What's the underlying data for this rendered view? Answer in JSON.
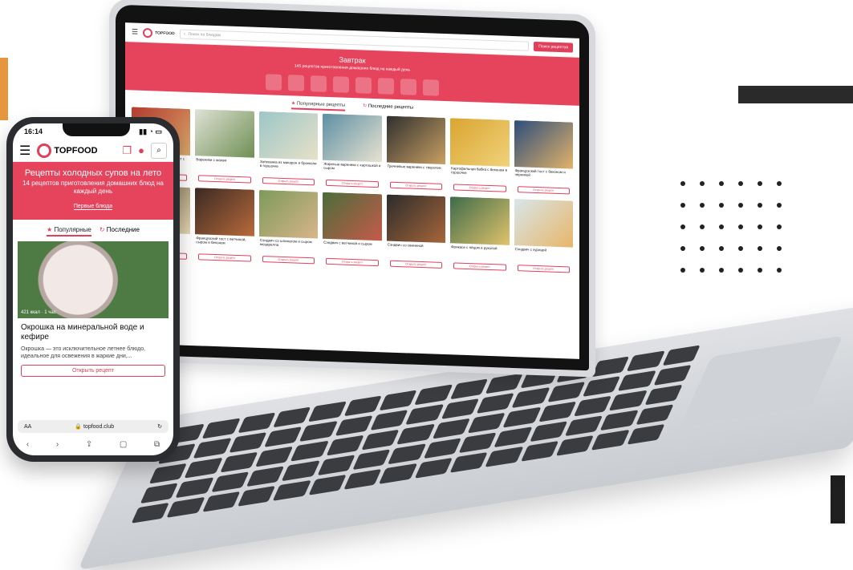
{
  "laptop": {
    "site": {
      "logo": "TOPFOOD",
      "search_placeholder": "Поиск по блюдам",
      "search_button": "Поиск рецептов",
      "hero_title": "Завтрак",
      "hero_subtitle": "145 рецептов приготовления домашних блюд на каждый день",
      "tabs": [
        "Популярные рецепты",
        "Последние рецепты"
      ],
      "cards": [
        "Хрустящий французский тост с малиной",
        "Вареники с маком",
        "Запеканка из макарон и брокколи в горшочке",
        "Жареные вареники с картошкой и сыром",
        "Гречневые вареники с творогом",
        "Картофельная бабка с беконом в горшочке",
        "Французский тост с беконом и черникой",
        "Запеканка из капусты в мультиварке",
        "Французский тост с ветчиной, сыром и беконом",
        "Сэндвич со шпинатом и сыром моцарелла",
        "Сэндвич с ветчиной и сыром",
        "Сэндвич со свининой",
        "Фрикасе с яйцом и руколой",
        "Сэндвич с курицей"
      ],
      "card_button": "Открыть рецепт"
    }
  },
  "phone": {
    "status_time": "16:14",
    "logo": "TOPFOOD",
    "hero_title": "Рецепты холодных супов на лето",
    "hero_subtitle": "14 рецептов приготовления домашних блюд на каждый день",
    "hero_link": "Первые блюда",
    "tabs": [
      "Популярные",
      "Последние"
    ],
    "card_meta": "421 ккал · 1 час",
    "card_title": "Окрошка на минеральной воде и кефире",
    "card_text": "Окрошка — это исключительное летнее блюдо, идеальное для освежения в жаркие дни,...",
    "card_button": "Открыть рецепт",
    "url": "topfood.club",
    "url_left": "AA"
  },
  "colors": {
    "brand": "#e0405b",
    "hero": "#e6435d",
    "accent_orange": "#e5963f"
  }
}
